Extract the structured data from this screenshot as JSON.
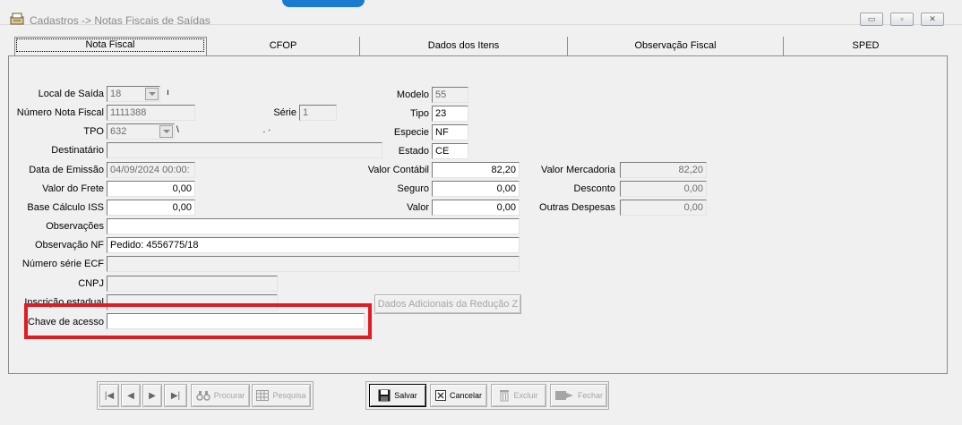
{
  "window": {
    "title": "Cadastros -> Notas Fiscais de Saídas",
    "controls": {
      "minimize": "▭",
      "restore": "▫",
      "close": "✕"
    }
  },
  "tabs": [
    {
      "label": "Nota Fiscal",
      "active": true
    },
    {
      "label": "CFOP",
      "active": false
    },
    {
      "label": "Dados dos Itens",
      "active": false
    },
    {
      "label": "Observação Fiscal",
      "active": false
    },
    {
      "label": "SPED",
      "active": false
    }
  ],
  "form": {
    "local_saida": {
      "label": "Local de Saída",
      "value": "18"
    },
    "modelo": {
      "label": "Modelo",
      "value": "55"
    },
    "numero_nf": {
      "label": "Número Nota Fiscal",
      "value": "1111388"
    },
    "serie": {
      "label": "Série",
      "value": "1"
    },
    "tipo": {
      "label": "Tipo",
      "value": "23"
    },
    "tpo": {
      "label": "TPO",
      "value": "632"
    },
    "especie": {
      "label": "Especie",
      "value": "NF"
    },
    "destinatario": {
      "label": "Destinatário",
      "value": ""
    },
    "estado": {
      "label": "Estado",
      "value": "CE"
    },
    "data_emissao": {
      "label": "Data de Emissão",
      "value": "04/09/2024 00:00:"
    },
    "valor_contabil": {
      "label": "Valor Contábil",
      "value": "82,20"
    },
    "valor_mercadoria": {
      "label": "Valor Mercadoria",
      "value": "82,20"
    },
    "valor_frete": {
      "label": "Valor do Frete",
      "value": "0,00"
    },
    "seguro": {
      "label": "Seguro",
      "value": "0,00"
    },
    "desconto": {
      "label": "Desconto",
      "value": "0,00"
    },
    "base_calculo_iss": {
      "label": "Base Cálculo ISS",
      "value": "0,00"
    },
    "valor": {
      "label": "Valor",
      "value": "0,00"
    },
    "outras_despesas": {
      "label": "Outras Despesas",
      "value": "0,00"
    },
    "observacoes": {
      "label": "Observações",
      "value": ""
    },
    "observacao_nf": {
      "label": "Observação NF",
      "value": "Pedido: 4556775/18"
    },
    "numero_serie_ecf": {
      "label": "Número série ECF",
      "value": ""
    },
    "cnpj": {
      "label": "CNPJ",
      "value": ""
    },
    "inscricao_estadual": {
      "label": "Inscrição estadual",
      "value": ""
    },
    "chave_acesso": {
      "label": "Chave de acesso",
      "value": ""
    },
    "dados_adicionais_button": "Dados Adicionais da Redução Z"
  },
  "toolbar": {
    "first": "|◀",
    "prev": "◀",
    "next": "▶",
    "last": "▶|",
    "procurar": "Procurar",
    "pesquisa": "Pesquisa",
    "salvar": "Salvar",
    "cancelar": "Cancelar",
    "excluir": "Excluir",
    "fechar": "Fechar"
  },
  "colors": {
    "highlight": "#e11b22",
    "accent": "#1a7bd0"
  }
}
